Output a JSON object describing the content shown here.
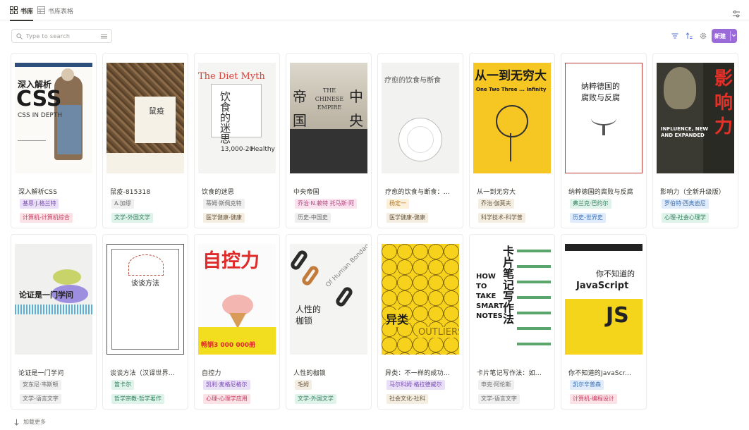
{
  "tabs": [
    {
      "label": "书库",
      "active": true
    },
    {
      "label": "书库表格",
      "active": false
    }
  ],
  "search": {
    "placeholder": "Type to search"
  },
  "toolbar": {
    "new_label": "新建"
  },
  "accent_color": "#9a6bd8",
  "footer": {
    "load_more": "加载更多"
  },
  "books": [
    {
      "title": "深入解析CSS",
      "author": "基思·J.格兰特",
      "category": "计算机-计算机综合",
      "cover_text": [
        "深入解析",
        "CSS",
        "CSS IN DEPTH"
      ],
      "author_bg": "#e9e0f7",
      "author_fg": "#7b4bb5",
      "cat_bg": "#fbe2e7",
      "cat_fg": "#c23a5d"
    },
    {
      "title": "鼠疫-815318",
      "author": "A.加缪",
      "category": "文学-外国文学",
      "cover_text": [
        "鼠疫"
      ],
      "author_bg": "#efefef",
      "author_fg": "#6b6b6b",
      "cat_bg": "#dff3ea",
      "cat_fg": "#2f7d5b"
    },
    {
      "title": "饮食的迷思",
      "author": "蒂姆·斯佩克特",
      "category": "医学健康-健康",
      "cover_text": [
        "The Diet Myth",
        "饮食的迷思",
        "13,000-20",
        "Healthy"
      ],
      "author_bg": "#efefef",
      "author_fg": "#6b6b6b",
      "cat_bg": "#f4ede2",
      "cat_fg": "#6b5a3e"
    },
    {
      "title": "中央帝国",
      "author": "乔治·N.赖特 托马斯·阿",
      "category": "历史-中国史",
      "cover_text": [
        "帝",
        "中",
        "国",
        "央",
        "THE CHINESE EMPIRE"
      ],
      "author_bg": "#fbe2ef",
      "author_fg": "#b2457c",
      "cat_bg": "#efefef",
      "cat_fg": "#6b6b6b"
    },
    {
      "title": "疗愈的饮食与断食：...",
      "author": "杨定一",
      "category": "医学健康-健康",
      "cover_text": [
        "疗愈的饮食与断食"
      ],
      "author_bg": "#fdf0db",
      "author_fg": "#b5761c",
      "cat_bg": "#f4ede2",
      "cat_fg": "#6b5a3e"
    },
    {
      "title": "从一到无穷大",
      "author": "乔治·伽莫夫",
      "category": "科学技术-科学普",
      "cover_text": [
        "从一到无穷大",
        "One Two Three ... Infinity"
      ],
      "author_bg": "#f4ede2",
      "author_fg": "#6b5a3e",
      "cat_bg": "#f4ede2",
      "cat_fg": "#6b5a3e"
    },
    {
      "title": "纳粹德国的腐败与反腐",
      "author": "弗兰克·巴约尔",
      "category": "历史-世界史",
      "cover_text": [
        "纳粹德国的",
        "腐败与反腐"
      ],
      "author_bg": "#dff3ea",
      "author_fg": "#2f7d5b",
      "cat_bg": "#e0ecfb",
      "cat_fg": "#3a6fb5"
    },
    {
      "title": "影响力（全新升级版）",
      "author": "罗伯特·西奥迪尼",
      "category": "心理-社会心理学",
      "cover_text": [
        "影",
        "响",
        "力",
        "INFLUENCE, NEW AND EXPANDED"
      ],
      "author_bg": "#e0ecfb",
      "author_fg": "#3a6fb5",
      "cat_bg": "#dff3ea",
      "cat_fg": "#2f7d5b"
    },
    {
      "title": "论证是一门学问",
      "author": "安东尼·韦斯顿",
      "category": "文学-语言文字",
      "cover_text": [
        "论证是一门学问"
      ],
      "author_bg": "#efefef",
      "author_fg": "#6b6b6b",
      "cat_bg": "#efefef",
      "cat_fg": "#6b6b6b"
    },
    {
      "title": "谈谈方法（汉译世界...",
      "author": "笛卡尔",
      "category": "哲学宗教-哲学著作",
      "cover_text": [
        "谈谈方法"
      ],
      "author_bg": "#dff3ea",
      "author_fg": "#2f7d5b",
      "cat_bg": "#dff3ea",
      "cat_fg": "#2f7d5b"
    },
    {
      "title": "自控力",
      "author": "凯利·麦格尼格尔",
      "category": "心理-心理学应用",
      "cover_text": [
        "自控力",
        "畅销3 000 000册"
      ],
      "author_bg": "#e9e0f7",
      "author_fg": "#7b4bb5",
      "cat_bg": "#fbe2e7",
      "cat_fg": "#c23a5d"
    },
    {
      "title": "人性的枷锁",
      "author": "毛姆",
      "category": "文学-外国文学",
      "cover_text": [
        "人性的",
        "枷锁",
        "Of Human Bondage"
      ],
      "author_bg": "#f4ede2",
      "author_fg": "#6b5a3e",
      "cat_bg": "#dff3ea",
      "cat_fg": "#2f7d5b"
    },
    {
      "title": "异类：不一样的成功...",
      "author": "马尔科姆·格拉德威尔",
      "category": "社会文化-社科",
      "cover_text": [
        "异类",
        "OUTLIERS"
      ],
      "author_bg": "#e9e0f7",
      "author_fg": "#7b4bb5",
      "cat_bg": "#f4ede2",
      "cat_fg": "#6b5a3e"
    },
    {
      "title": "卡片笔记写作法：如...",
      "author": "申克·阿伦斯",
      "category": "文学-语言文字",
      "cover_text": [
        "卡片笔记写作法",
        "HOW TO TAKE SMART NOTES"
      ],
      "author_bg": "#efefef",
      "author_fg": "#6b6b6b",
      "cat_bg": "#efefef",
      "cat_fg": "#6b6b6b"
    },
    {
      "title": "你不知道的JavaScr...",
      "author": "凯尔辛普森",
      "category": "计算机-编程设计",
      "cover_text": [
        "你不知道的",
        "JavaScript",
        "JS"
      ],
      "author_bg": "#e0ecfb",
      "author_fg": "#3a6fb5",
      "cat_bg": "#fbe2e7",
      "cat_fg": "#c23a5d"
    }
  ]
}
